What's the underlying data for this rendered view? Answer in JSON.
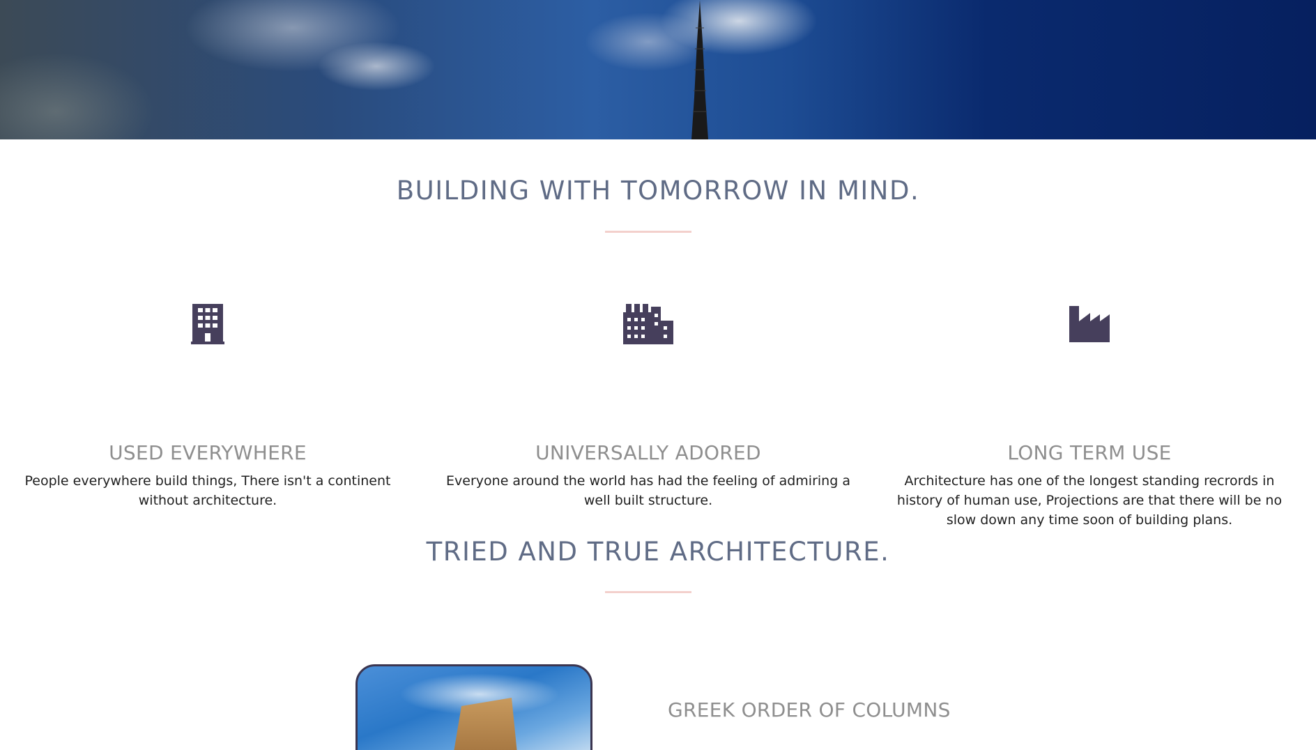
{
  "hero": {
    "image_icon": "cathedral-spire-sky"
  },
  "section1": {
    "title": "BUILDING WITH TOMORROW IN MIND."
  },
  "features": [
    {
      "icon": "building-icon",
      "title": "USED EVERYWHERE",
      "text": "People everywhere build things, There isn't a continent without architecture."
    },
    {
      "icon": "city-icon",
      "title": "UNIVERSALLY ADORED",
      "text": "Everyone around the world has had the feeling of admiring a well built structure."
    },
    {
      "icon": "industry-icon",
      "title": "LONG TERM USE",
      "text": "Architecture has one of the longest standing recrords in history of human use, Projections are that there will be no slow down any time soon of building plans."
    }
  ],
  "section2": {
    "title": "TRIED AND TRUE ARCHITECTURE."
  },
  "card": {
    "title": "GREEK ORDER OF COLUMNS"
  },
  "colors": {
    "title": "#5f6b85",
    "divider": "#f3d0cc",
    "icon": "#463f5c",
    "feature_title": "#8e8e8e"
  }
}
